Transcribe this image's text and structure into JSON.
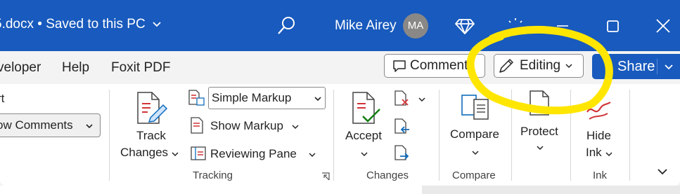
{
  "titlebar": {
    "doc_title": "5.docx • Saved to this PC",
    "user_name": "Mike Airey",
    "avatar_initials": "MA",
    "bg_color": "#185abd"
  },
  "menubar": {
    "items": [
      "veloper",
      "Help",
      "Foxit PDF"
    ],
    "comments_label": "Comments",
    "editing_label": "Editing",
    "share_label": "Share"
  },
  "ribbon": {
    "partial_label": "rt",
    "comments_dropdown": "ow Comments",
    "tracking": {
      "group_label": "Tracking",
      "track_changes_line1": "Track",
      "track_changes_line2": "Changes",
      "markup_select": "Simple Markup",
      "show_markup": "Show Markup",
      "reviewing_pane": "Reviewing Pane"
    },
    "changes": {
      "group_label": "Changes",
      "accept": "Accept"
    },
    "compare": {
      "group_label": "Compare",
      "compare": "Compare"
    },
    "protect": {
      "protect": "Protect"
    },
    "ink": {
      "group_label": "Ink",
      "hide_line1": "Hide",
      "hide_line2": "Ink"
    }
  },
  "colors": {
    "accent": "#185abd",
    "highlight": "#ffe600",
    "icon_red": "#d13438",
    "icon_green": "#107c10",
    "icon_blue": "#0f6cbd"
  }
}
